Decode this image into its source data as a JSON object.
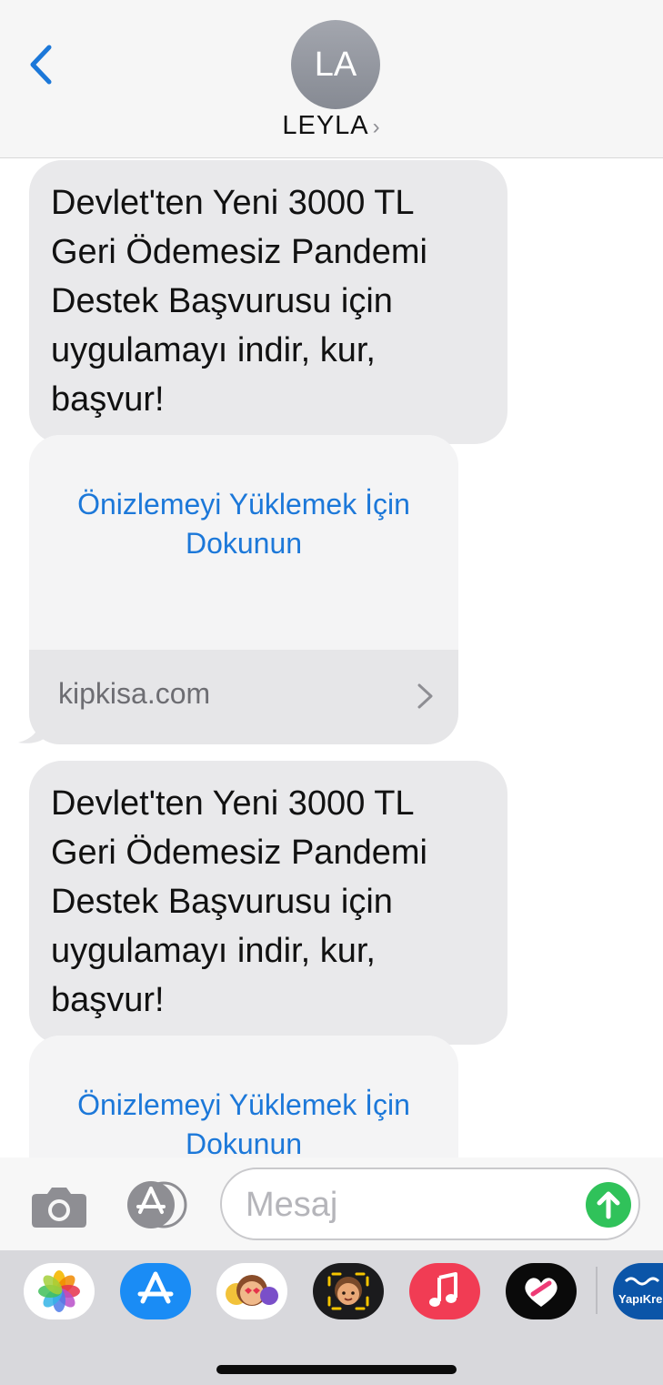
{
  "header": {
    "contact_initials": "LA",
    "contact_name": "LEYLA",
    "contact_chevron": "›",
    "back_icon": "chevron-left-icon"
  },
  "messages": [
    {
      "text": "Devlet'ten Yeni 3000 TL Geri Ödemesiz Pandemi Destek Başvurusu için uygulamayı indir, kur, başvur!",
      "link_preview": {
        "prompt": "Önizlemeyi Yüklemek İçin Dokunun",
        "domain": "kipkisa.com"
      }
    },
    {
      "text": "Devlet'ten Yeni 3000 TL Geri Ödemesiz Pandemi Destek Başvurusu için uygulamayı indir, kur, başvur!",
      "link_preview": {
        "prompt": "Önizlemeyi Yüklemek İçin Dokunun"
      }
    }
  ],
  "compose": {
    "placeholder": "Mesaj",
    "camera_icon": "camera-icon",
    "apps_icon": "app-store-icon",
    "send_icon": "send-arrow-icon"
  },
  "drawer": {
    "apps": [
      {
        "name": "photos-icon"
      },
      {
        "name": "app-store-icon"
      },
      {
        "name": "animoji-icon"
      },
      {
        "name": "memoji-icon"
      },
      {
        "name": "music-icon"
      },
      {
        "name": "digital-touch-icon"
      },
      {
        "name": "yapikredi-icon",
        "label": "YapıKre"
      }
    ]
  },
  "colors": {
    "accent": "#1c78d9",
    "bubble_gray": "#e9e9eb",
    "send_green": "#30c25a",
    "header_bg": "#f6f6f6"
  }
}
